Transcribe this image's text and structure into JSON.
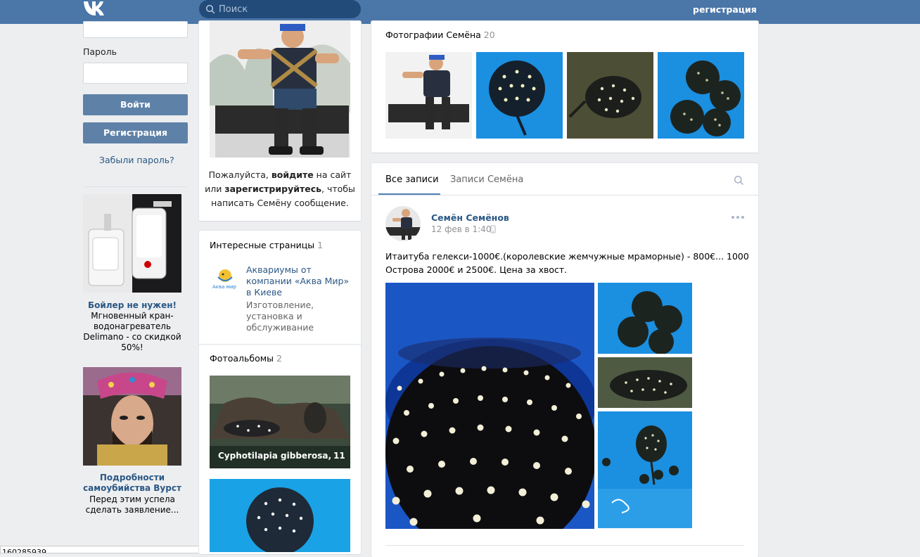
{
  "header": {
    "search_placeholder": "Поиск",
    "register_link": "регистрация"
  },
  "login": {
    "password_label": "Пароль",
    "login_button": "Войти",
    "register_button": "Регистрация",
    "forgot_link": "Забыли пароль?"
  },
  "ads": [
    {
      "title": "Бойлер не нужен!",
      "lines": [
        "Мгновенный кран-",
        "водонагреватель",
        "Delimano - со скидкой",
        "50%!"
      ]
    },
    {
      "title_lines": [
        "Подробности",
        "самоубийства Вурст"
      ],
      "lines": [
        "Перед этим успела",
        "сделать заявление..."
      ]
    }
  ],
  "bottom_clip_text": "160285939",
  "profile": {
    "message_lines": [
      [
        "Пожалуйста, ",
        "войдите",
        " на сайт"
      ],
      [
        "или ",
        "зарегистрируйтесь",
        ", чтобы"
      ],
      [
        "написать Семёну сообщение."
      ]
    ]
  },
  "interesting": {
    "title": "Интересные страницы",
    "count": "1",
    "item_name_lines": [
      "Аквариумы от",
      "компании «Аква Мир»",
      "в Киеве"
    ],
    "item_desc_lines": [
      "Изготовление,",
      "установка и",
      "обслуживание"
    ]
  },
  "albums": {
    "title": "Фотоальбомы",
    "count": "2",
    "album1_name": "Cyphotilapia gibberosa,...",
    "album1_count": "11"
  },
  "photos": {
    "title": "Фотографии Семёна",
    "count": "20"
  },
  "wall": {
    "tabs": [
      "Все записи",
      "Записи Семёна"
    ]
  },
  "post": {
    "author": "Семён Семёнов",
    "date": "12 фев в 1:40",
    "text_lines": [
      "Итаитуба гелекси-1000€.(королевские жемчужные мраморные) - 800€... 1000",
      "Острова 2000€ и 2500€. Цена за хвост."
    ]
  },
  "colors": {
    "header_bg": "#4a76a8",
    "link": "#2a5885",
    "button": "#5e81a8",
    "page_bg": "#edeef0"
  }
}
